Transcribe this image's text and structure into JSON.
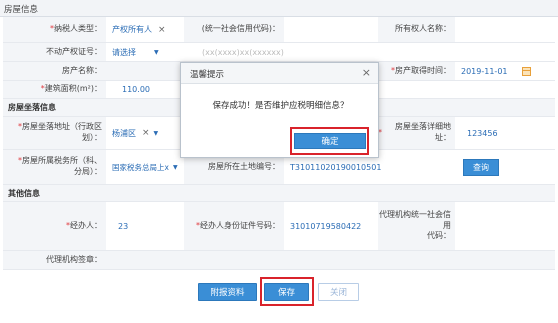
{
  "window": {
    "title": "房屋信息"
  },
  "form": {
    "taxpayer_type_label": "纳税人类型：",
    "taxpayer_type_value": "产权所有人",
    "social_credit_label": "(统一社会信用代码)：",
    "owner_name_label": "所有权人名称：",
    "property_cert_label": "不动产权证号：",
    "property_cert_value": "请选择",
    "property_cert_placeholder": "(xx(xxxx)xx(xxxxxx)",
    "house_name_label": "房产名称：",
    "acquire_time_label": "房产取得时间：",
    "acquire_time_value": "2019-11-01",
    "area_label": "建筑面积(m²)：",
    "area_value": "110.00",
    "location_section": "房屋坐落信息",
    "district_label_1": "房屋坐落地址（行政区",
    "district_label_2": "划）：",
    "district_value": "杨浦区",
    "detail_addr_label": "房屋坐落详细地址：",
    "detail_addr_value": "123456",
    "tax_office_label_1": "房屋所属税务所（科、",
    "tax_office_label_2": "分局）：",
    "tax_office_value": "国家税务总局上x",
    "land_no_label": "房屋所在土地编号：",
    "land_no_value": "T31011020190010501",
    "query_button": "查询",
    "other_section": "其他信息",
    "agent_label": "经办人：",
    "agent_value": "23",
    "agent_id_label": "经办人身份证件号码：",
    "agent_id_value": "31010719580422",
    "agency_credit_label_1": "代理机构统一社会信用",
    "agency_credit_label_2": "代码：",
    "agency_sign_label": "代理机构签章："
  },
  "buttons": {
    "attach": "附报资料",
    "save": "保存",
    "close": "关闭"
  },
  "dialog": {
    "title": "温馨提示",
    "close_glyph": "×",
    "message": "保存成功！是否维护应税明细信息？",
    "ok": "确定"
  },
  "icons": {
    "clear_glyph": "×",
    "dropdown_glyph": "▼"
  },
  "colors": {
    "accent": "#3a8ed6",
    "highlight": "#d9232b",
    "required": "#e0393e"
  }
}
